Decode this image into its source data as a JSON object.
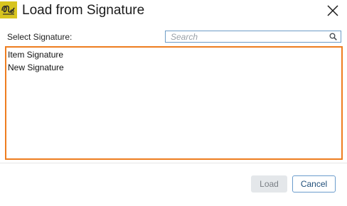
{
  "window": {
    "title": "Load from Signature",
    "app_icon": "signature-app-icon",
    "close_icon": "close-icon"
  },
  "select_label": "Select Signature:",
  "search": {
    "placeholder": "Search",
    "value": "",
    "icon": "search-icon"
  },
  "signatures": [
    {
      "label": "Item Signature"
    },
    {
      "label": "New Signature"
    }
  ],
  "buttons": {
    "load_label": "Load",
    "load_enabled": false,
    "cancel_label": "Cancel"
  },
  "colors": {
    "list_border": "#ee7d1f",
    "search_border": "#6e9cc6",
    "app_icon_bg": "#d4c21e",
    "cancel_border": "#6b9ccc",
    "load_disabled_bg": "#e4e7ea"
  }
}
